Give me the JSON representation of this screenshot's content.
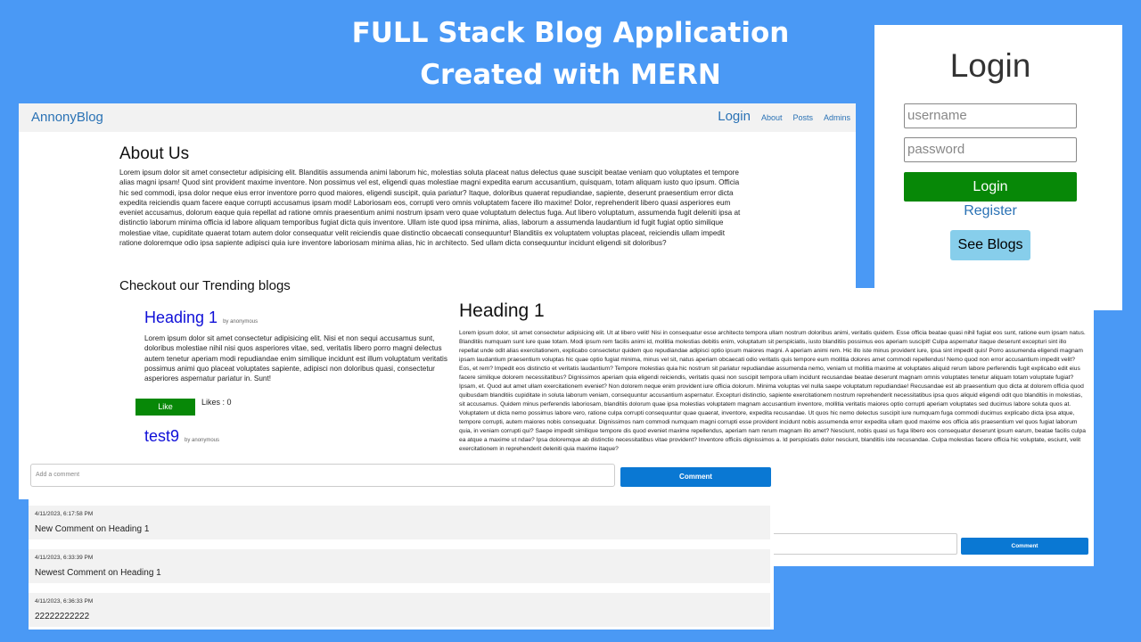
{
  "promo": {
    "line1": "FULL Stack Blog Application",
    "line2": "Created with MERN"
  },
  "blog": {
    "brand": "AnnonyBlog",
    "nav": {
      "login": "Login",
      "about": "About",
      "posts": "Posts",
      "admins": "Admins"
    },
    "about_title": "About Us",
    "about_text": "Lorem ipsum dolor sit amet consectetur adipisicing elit. Blanditiis assumenda animi laborum hic, molestias soluta placeat natus delectus quae suscipit beatae veniam quo voluptates et tempore alias magni ipsam! Quod sint provident maxime inventore. Non possimus vel est, eligendi quas molestiae magni expedita earum accusantium, quisquam, totam aliquam iusto quo ipsum. Officia hic sed commodi, ipsa dolor neque eius error inventore porro quod maiores, eligendi suscipit, quia pariatur? Itaque, doloribus quaerat repudiandae, sapiente, deserunt praesentium error dicta expedita reiciendis quam facere eaque corrupti accusamus ipsam modi! Laboriosam eos, corrupti vero omnis voluptatem facere illo maxime! Dolor, reprehenderit libero quasi asperiores eum eveniet accusamus, dolorum eaque quia repellat ad ratione omnis praesentium animi nostrum ipsam vero quae voluptatum delectus fuga. Aut libero voluptatum, assumenda fugit deleniti ipsa at distinctio laborum minima officia id labore aliquam temporibus fugiat dicta quis inventore. Ullam iste quod ipsa minima, alias, laborum a assumenda laudantium id fugit fugiat optio similique molestiae vitae, cupiditate quaerat totam autem dolor consequatur velit reiciendis quae distinctio obcaecati consequuntur! Blanditiis ex voluptatem voluptas placeat, reiciendis ullam impedit ratione doloremque odio ipsa sapiente adipisci quia iure inventore laboriosam minima alias, hic in architecto. Sed ullam dicta consequuntur incidunt eligendi sit doloribus?",
    "trending_title": "Checkout our Trending blogs",
    "card": {
      "heading": "Heading 1",
      "by": "by anonymous",
      "text": "Lorem ipsum dolor sit amet consectetur adipisicing elit. Nisi et non sequi accusamus sunt, doloribus molestiae nihil nisi quos asperiores vitae, sed, veritatis libero porro magni delectus autem tenetur aperiam modi repudiandae enim similique incidunt est illum voluptatum veritatis possimus animi quo placeat voluptates sapiente, adipisci non doloribus quasi, consectetur asperiores aspernatur pariatur in. Sunt!",
      "like_label": "Like",
      "likes_text": "Likes : 0"
    },
    "card2": {
      "heading": "test9",
      "by": "by anonymous"
    }
  },
  "comments": {
    "placeholder": "Add a comment",
    "button": "Comment",
    "items": [
      {
        "timestamp": "4/11/2023, 6:17:58 PM",
        "text": "New Comment on Heading 1"
      },
      {
        "timestamp": "4/11/2023, 6:33:39 PM",
        "text": "Newest Comment on Heading 1"
      },
      {
        "timestamp": "4/11/2023, 6:36:33 PM",
        "text": "22222222222"
      }
    ]
  },
  "login": {
    "title": "Login",
    "username_placeholder": "username",
    "password_placeholder": "password",
    "login_button": "Login",
    "register_link": "Register",
    "see_blogs_button": "See Blogs"
  },
  "post": {
    "title": "Heading 1",
    "body": "Lorem ipsum dolor, sit amet consectetur adipisicing elit. Ut at libero velit! Nisi in consequatur esse architecto tempora ullam nostrum doloribus animi, veritatis quidem. Esse officia beatae quasi nihil fugiat eos sunt, ratione eum ipsam natus. Blanditiis numquam sunt iure quae totam. Modi ipsum rem facilis animi id, mollitia molestias debitis enim, voluptatum sit perspiciatis, iusto blanditiis possimus eos aperiam suscipit! Culpa aspernatur itaque deserunt excepturi sint illo repellat unde odit alias exercitationem, explicabo consectetur quidem quo repudiandae adipisci optio ipsum maiores magni. A aperiam animi rem. Hic illo iste minus provident iure, ipsa sint impedit quis! Porro assumenda eligendi magnam ipsam laudantium praesentium voluptas hic quae optio fugiat minima, minus vel sit, natus aperiam obcaecati odio veritatis quis tempore eum mollitia dolores amet commodi repellendus! Nemo quod non error accusantium impedit velit? Eos, et rem? Impedit eos distinctio et veritatis laudantium? Tempore molestias quia hic nostrum sit pariatur repudiandae assumenda nemo, veniam ut mollitia maxime at voluptates aliquid rerum labore perferendis fugit explicabo edit eius facere similique dolorem necessitatibus? Dignissimos aperiam quia eligendi reiciendis, veritatis quasi non suscipit tempora ullam incidunt recusandae beatae deserunt magnam omnis voluptates tenetur aliquam totam voluptate fugiat? Ipsam, et. Quod aut amet ullam exercitationem eveniet? Non dolorem neque enim provident iure officia dolorum. Minima voluptas vel nulla saepe voluptatum repudiandae! Recusandae est ab praesentium quo dicta at dolorem officia quod quibusdam blanditiis cupiditate in soluta laborum veniam, consequuntur accusantium aspernatur. Excepturi distinctio, sapiente exercitationem nostrum reprehenderit necessitatibus ipsa quos aliquid eligendi odit quo blanditiis in molestias, sit accusamus. Quidem minus perferendis laboriosam, blanditiis dolorum quae ipsa molestias voluptatem magnam accusantium inventore, mollitia veritatis maiores optio corrupti aperiam voluptates sed ducimus labore soluta quos at. Voluptatem ut dicta nemo possimus labore vero, ratione culpa corrupti consequuntur quae quaerat, inventore, expedita recusandae. Ut quos hic nemo delectus suscipit iure numquam fuga commodi ducimus explicabo dicta ipsa atque, tempore corrupti, autem maiores nobis consequatur. Dignissimos nam commodi numquam magni corrupti esse provident incidunt nobis assumenda error expedita ullam quod maxime eos officia atis praesentium vel quos fugiat laborum quia, in veniam corrupti qui? Saepe impedit similique tempore dis quod eveniet maxime repellendus, aperiam nam rerum magnam illo amet? Nesciunt, nobis quasi us fuga libero eos consequatur deserunt ipsum earum, beatae facilis culpa ea atque a maxime ut ndae? Ipsa doloremque ab distinctio necessitatibus vitae provident? Inventore officiis dignissimos a. Id perspiciatis dolor nesciunt, blanditiis iste recusandae. Culpa molestias facere officia hic voluptate, esciunt, velit exercitationem in reprehenderit deleniti quia maxime itaque?",
    "comment_button": "Comment"
  }
}
